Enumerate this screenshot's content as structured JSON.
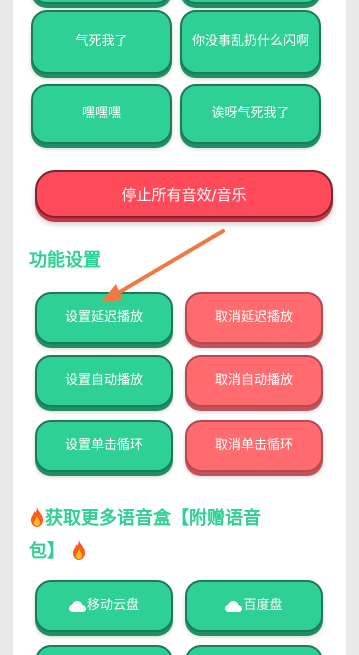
{
  "sound_buttons": [
    {
      "label": "气死我了"
    },
    {
      "label": "你没事乱扔什么闪啊"
    },
    {
      "label": "嘿嘿嘿"
    },
    {
      "label": "诶呀气死我了"
    }
  ],
  "stop_button": {
    "label": "停止所有音效/音乐"
  },
  "settings": {
    "title": "功能设置",
    "set_delay": "设置延迟播放",
    "cancel_delay": "取消延迟播放",
    "set_autoplay": "设置自动播放",
    "cancel_autoplay": "取消自动播放",
    "set_loop": "设置单击循环",
    "cancel_loop": "取消单击循环"
  },
  "more": {
    "title_line1": "获取更多语音盒【附赠语音",
    "title_line2": "包】",
    "icon": "fire-icon",
    "mobile_cloud": "移动云盘",
    "baidu_pan": "百度盘",
    "cloud_icon": "cloud-icon"
  },
  "colors": {
    "green": "#2fd095",
    "red": "#ff6b6f",
    "stop_red": "#ff4a5a",
    "arrow": "#f07a43"
  }
}
